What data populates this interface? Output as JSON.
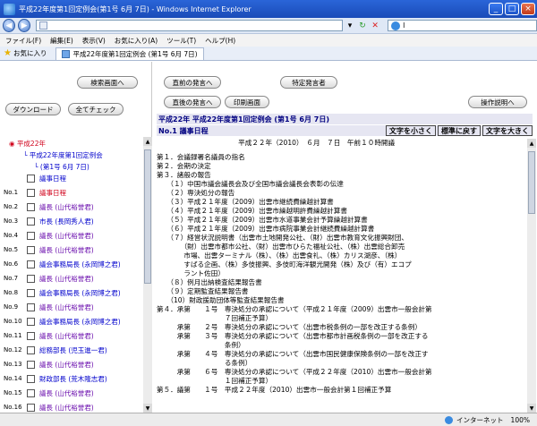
{
  "window": {
    "title": "平成22年度第1回定例会(第1号 6月 7日) - Windows Internet Explorer",
    "url": "",
    "search_text": "l",
    "minimize": "_",
    "maximize": "□",
    "close": "×"
  },
  "menu": [
    "ファイル(F)",
    "編集(E)",
    "表示(V)",
    "お気に入り(A)",
    "ツール(T)",
    "ヘルプ(H)"
  ],
  "favorites_label": "お気に入り",
  "tab_label": "平成22年度第1回定例会 (第1号 6月 7日)",
  "left": {
    "search_screen_button": "検索画面へ",
    "download_button": "ダウンロード",
    "check_all_button": "全てチェック",
    "tree_root": "平成22年",
    "tree_session": "平成22年度第1回定例会",
    "tree_issue": "(第1号 6月 7日)",
    "items": [
      {
        "no": "",
        "label": "議事日程",
        "style": "link"
      },
      {
        "no": "No.1",
        "label": "議事日程",
        "style": "red"
      },
      {
        "no": "No.2",
        "label": "議長 (山代裕誉君)",
        "style": "purple"
      },
      {
        "no": "No.3",
        "label": "市長 (長岡秀人君)",
        "style": "link"
      },
      {
        "no": "No.4",
        "label": "議長 (山代裕誉君)",
        "style": "purple"
      },
      {
        "no": "No.5",
        "label": "議長 (山代裕誉君)",
        "style": "purple"
      },
      {
        "no": "No.6",
        "label": "議会事務局長 (永岡博之君)",
        "style": "link"
      },
      {
        "no": "No.7",
        "label": "議長 (山代裕誉君)",
        "style": "purple"
      },
      {
        "no": "No.8",
        "label": "議会事務局長 (永岡博之君)",
        "style": "link"
      },
      {
        "no": "No.9",
        "label": "議長 (山代裕誉君)",
        "style": "purple"
      },
      {
        "no": "No.10",
        "label": "議会事務局長 (永岡博之君)",
        "style": "link"
      },
      {
        "no": "No.11",
        "label": "議長 (山代裕誉君)",
        "style": "purple"
      },
      {
        "no": "No.12",
        "label": "総務部長 (児玉進一君)",
        "style": "link"
      },
      {
        "no": "No.13",
        "label": "議長 (山代裕誉君)",
        "style": "purple"
      },
      {
        "no": "No.14",
        "label": "財政部長 (荒木隆志君)",
        "style": "link"
      },
      {
        "no": "No.15",
        "label": "議長 (山代裕誉君)",
        "style": "purple"
      },
      {
        "no": "No.16",
        "label": "議長 (山代裕誉君)",
        "style": "purple"
      }
    ]
  },
  "right": {
    "prev_speaker_button": "直前の発言へ",
    "next_speaker_button": "直後の発言へ",
    "print_button": "印刷画面",
    "specific_speaker_button": "特定発言者",
    "help_button": "操作説明へ",
    "header_title": "平成22年 平成22年度第1回定例会 (第1号 6月 7日)",
    "header_no": "No.1 議事日程",
    "font_smaller": "文字を小さく",
    "font_reset": "標準に戻す",
    "font_larger": "文字を大きく",
    "document_lines": [
      "　　　　　　　　　　　　平成２２年（2010）　６月　７日　午前１０時開議",
      "第１．会議録署名議員の指名",
      "第２．会期の決定",
      "第３．諸般の報告",
      "　　（１）中国市議会議長会及び全国市議会議長会表彰の伝達",
      "　　（２）専決処分の報告",
      "　　（３）平成２１年度（2009）出雲市継続費繰越計算書",
      "　　（４）平成２１年度（2009）出雲市繰越明許費繰越計算書",
      "　　（５）平成２１年度（2009）出雲市水道事業会計予算繰越計算書",
      "　　（６）平成２１年度（2009）出雲市病院事業会計継続費繰越計算書",
      "　　（７）経営状況説明書（出雲市土地開発公社、（財）出雲市教育文化振興財団、",
      "　　　　（財）出雲市都市公社、（財）出雲市ひらた福祉公社、（株）出雲総合卸売",
      "　　　　市場、出雲ターミナル（株）、（株）出雲食礼、（株）カリス湖彦、（株）",
      "　　　　すばる企画、（株）多伎振興、多伎町海洋観光開発（株）及び（有）エコプ",
      "　　　　ラント佐田）",
      "　　（８）例月出納検査結果報告書",
      "　　（９）定期監査結果報告書",
      "　　（10）財政援助団体等監査結果報告書",
      "第４．承第　　１号　専決処分の承認について（平成２１年度（2009）出雲市一般会計第",
      "　　　　　　　　　　７回補正予算）",
      "　　　承第　　２号　専決処分の承認について（出雲市税条例の一部を改正する条例）",
      "　　　承第　　３号　専決処分の承認について（出雲市都市計画税条例の一部を改正する",
      "　　　　　　　　　　条例）",
      "　　　承第　　４号　専決処分の承認について（出雲市国民健康保険条例の一部を改正す",
      "　　　　　　　　　　る条例）",
      "　　　承第　　６号　専決処分の承認について（平成２２年度（2010）出雲市一般会計第",
      "　　　　　　　　　　１回補正予算）",
      "第５．議第　　１号　平成２２年度（2010）出雲市一般会計第１回補正予算"
    ]
  },
  "status": {
    "zone": "インターネット",
    "zoom": "100%"
  }
}
